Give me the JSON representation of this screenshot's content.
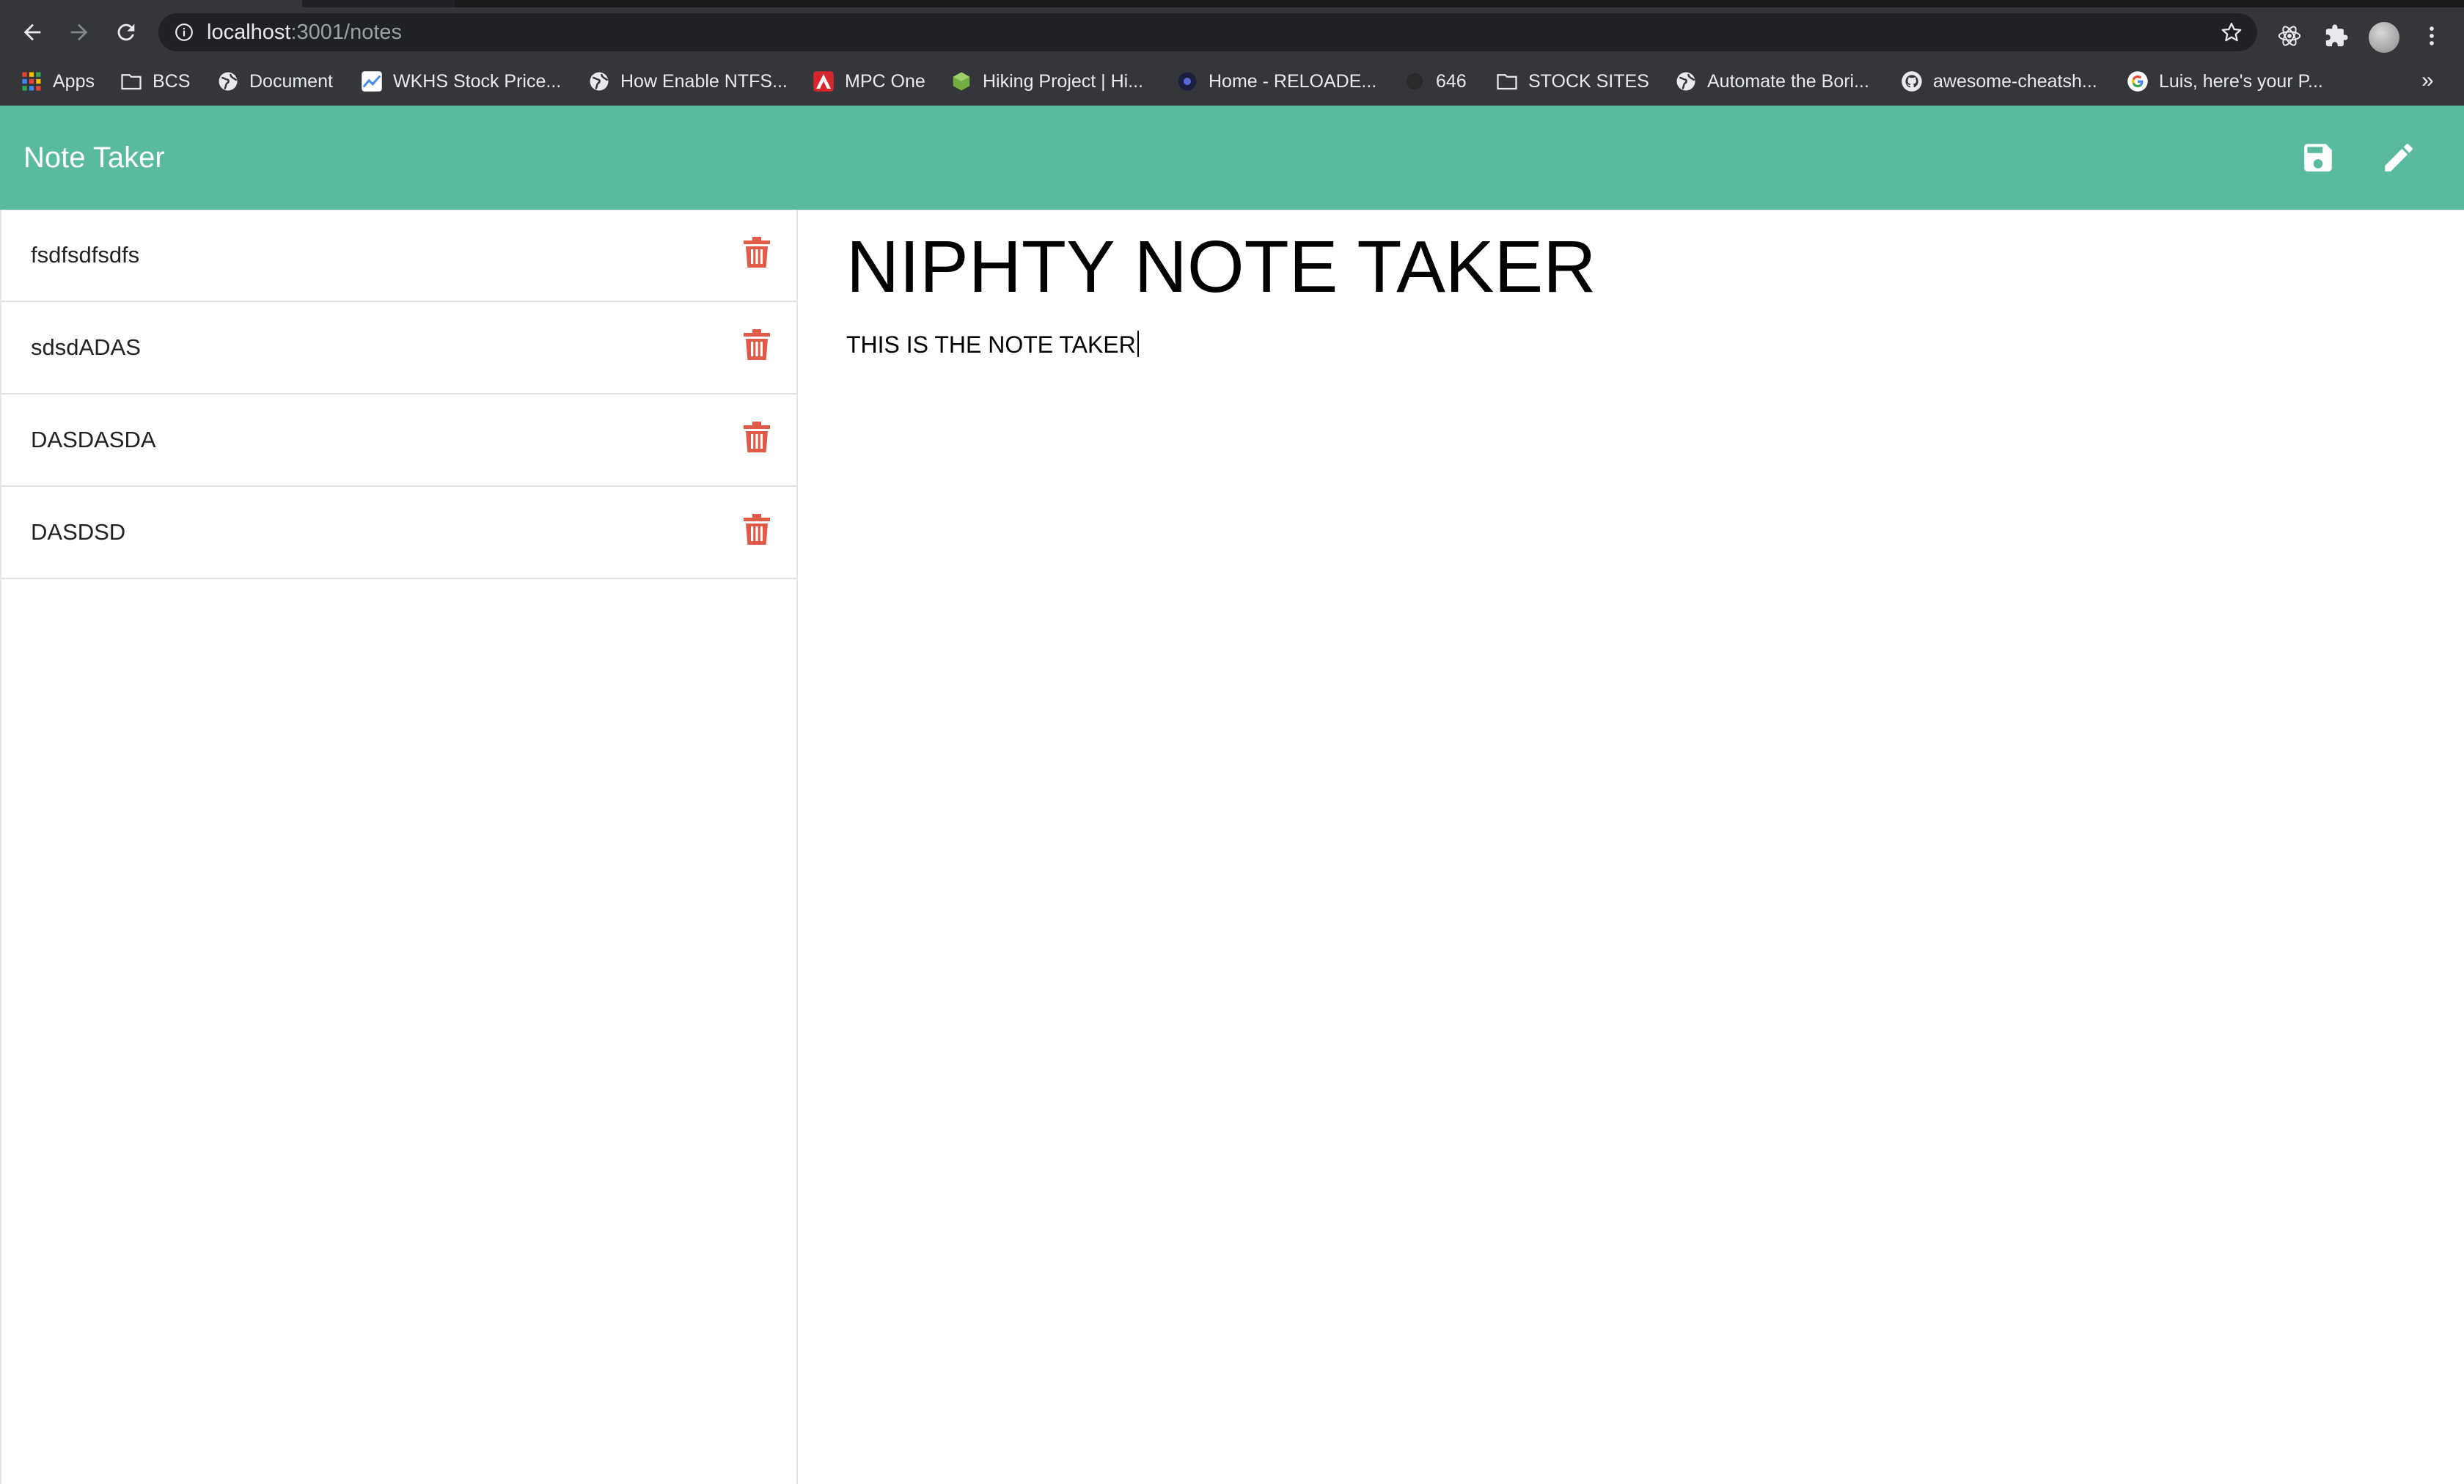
{
  "browser": {
    "url_host": "localhost",
    "url_path": ":3001/notes",
    "bookmarks": [
      {
        "label": "Apps",
        "icon": "apps-grid-icon"
      },
      {
        "label": "BCS",
        "icon": "folder-icon"
      },
      {
        "label": "Document",
        "icon": "globe-icon"
      },
      {
        "label": "WKHS Stock Price...",
        "icon": "chart-site-icon"
      },
      {
        "label": "How Enable NTFS...",
        "icon": "globe-icon"
      },
      {
        "label": "MPC One",
        "icon": "akai-logo-icon"
      },
      {
        "label": "Hiking Project | Hi...",
        "icon": "hiking-project-icon"
      },
      {
        "label": "Home - RELOADE...",
        "icon": "reloaded-icon"
      },
      {
        "label": "646",
        "icon": "blank-site-icon"
      },
      {
        "label": "STOCK SITES",
        "icon": "folder-icon"
      },
      {
        "label": "Automate the Bori...",
        "icon": "globe-icon"
      },
      {
        "label": "awesome-cheatsh...",
        "icon": "github-icon"
      },
      {
        "label": "Luis, here's your P...",
        "icon": "google-icon"
      }
    ],
    "overflow_label": "»"
  },
  "app": {
    "brand": "Note Taker",
    "accent_color": "#59baa0",
    "delete_color": "#e05a47"
  },
  "notes": [
    {
      "title": "fsdfsdfsdfs"
    },
    {
      "title": "sdsdADAS"
    },
    {
      "title": "DASDASDA"
    },
    {
      "title": "DASDSD"
    }
  ],
  "editor": {
    "title": "NIPHTY NOTE TAKER",
    "body": "THIS IS THE NOTE TAKER"
  }
}
